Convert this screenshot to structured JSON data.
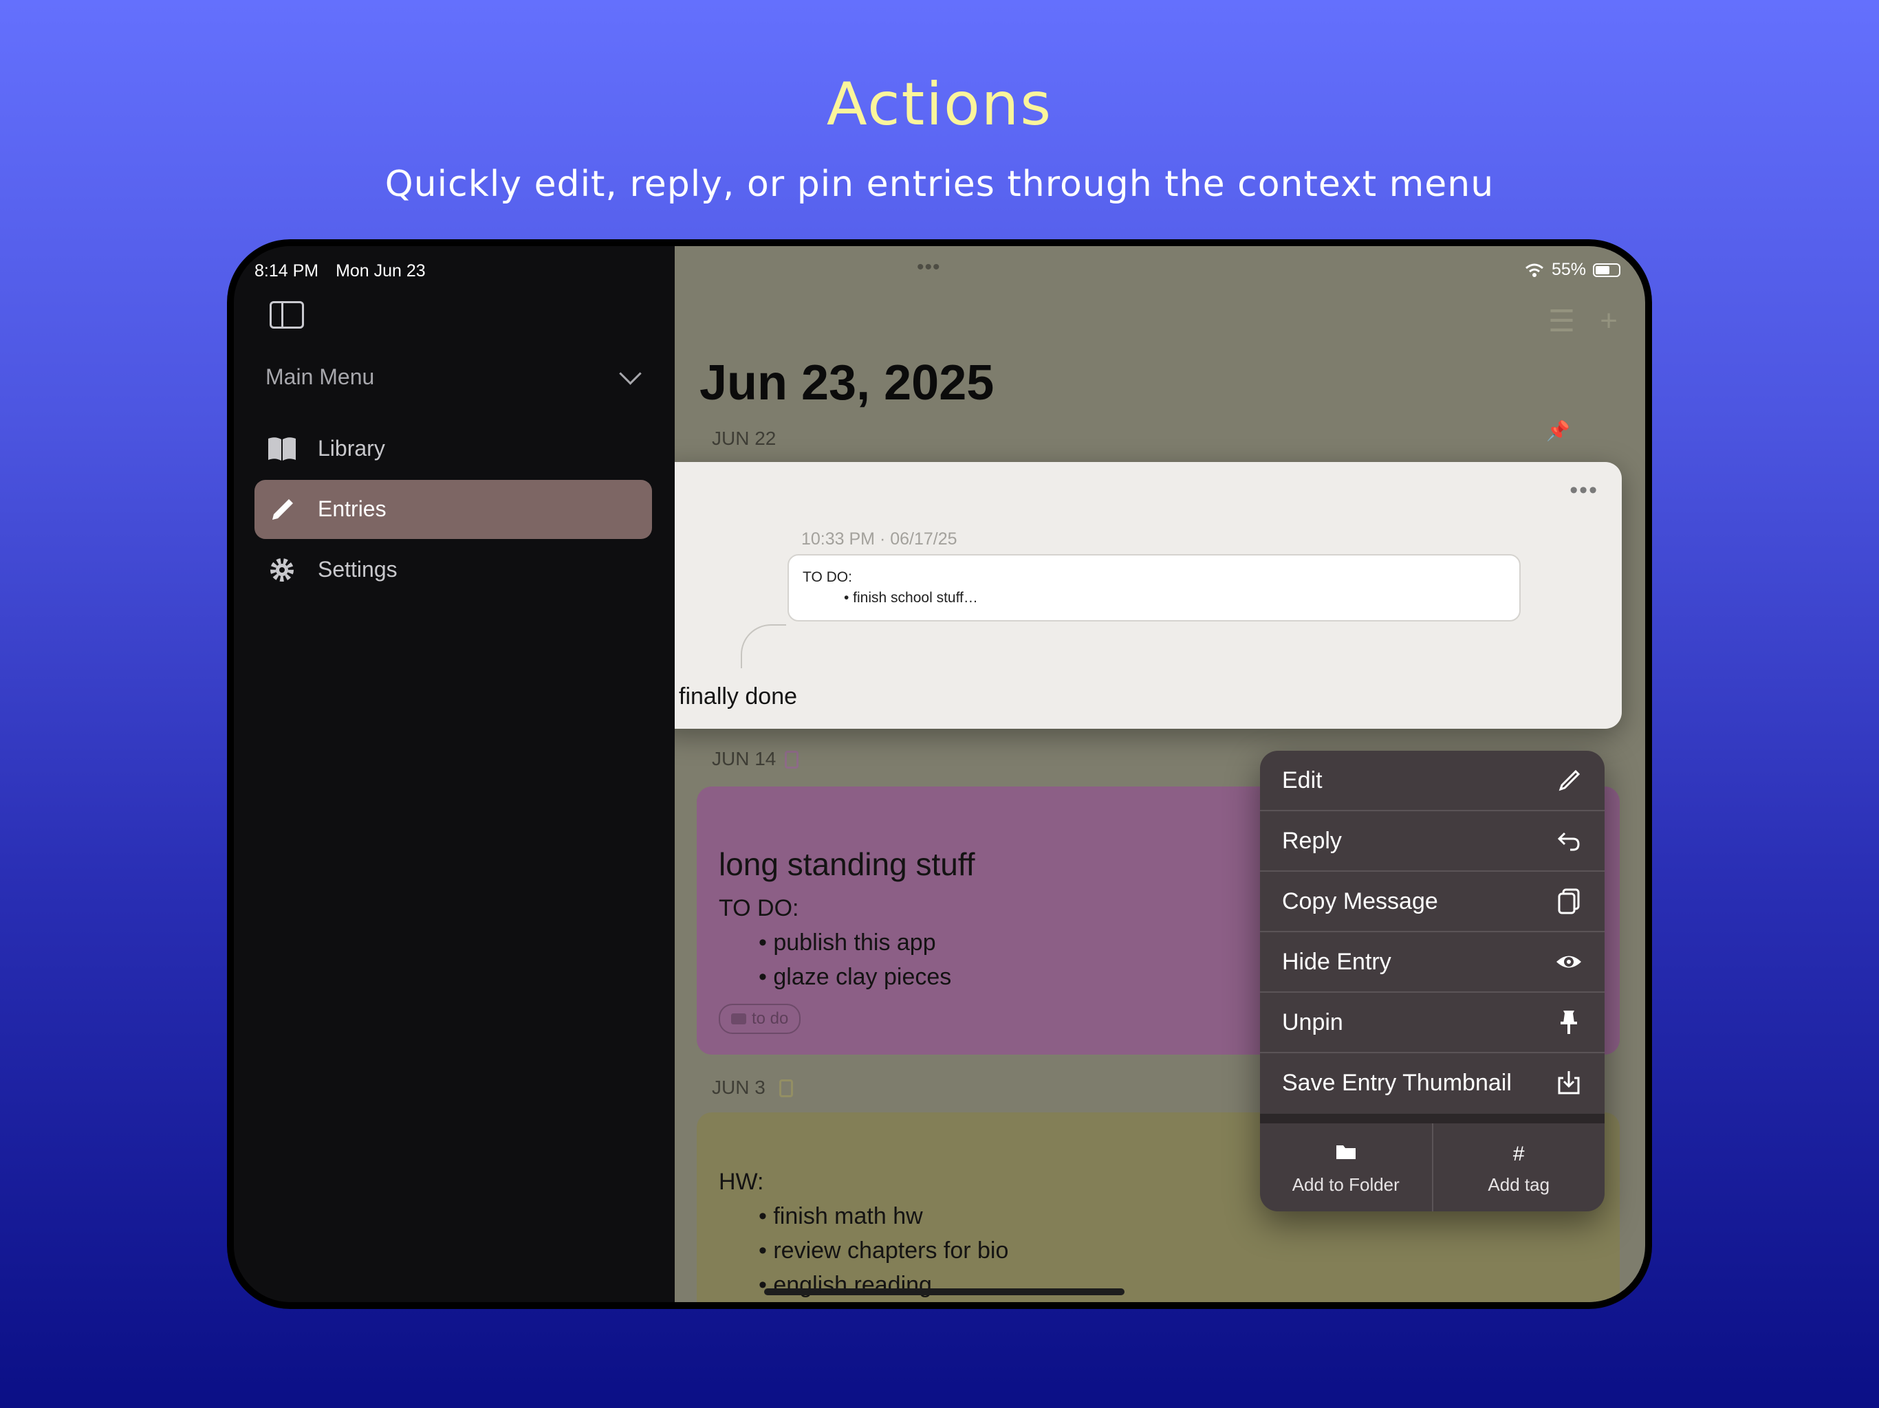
{
  "marketing": {
    "headline": "Actions",
    "subhead": "Quickly edit, reply, or pin entries through the context menu"
  },
  "status": {
    "time": "8:14 PM",
    "date": "Mon Jun 23",
    "battery": "55%"
  },
  "sidebar": {
    "menu_title": "Main Menu",
    "items": [
      {
        "label": "Library",
        "icon": "book-icon"
      },
      {
        "label": "Entries",
        "icon": "pencil-icon",
        "active": true
      },
      {
        "label": "Settings",
        "icon": "gear-icon"
      }
    ]
  },
  "main": {
    "page_title": "Jun 23, 2025",
    "days": [
      "JUN 22",
      "JUN 14",
      "JUN 3"
    ],
    "preview": {
      "timestamp": "10:33 PM · 06/17/25",
      "quote_line1": "TO DO:",
      "quote_line2": "• finish school stuff…",
      "reply_text": "finally done"
    },
    "card_purple": {
      "title": "long standing stuff",
      "line1": "TO DO:",
      "bullet1": "• publish this app",
      "bullet2": "• glaze clay pieces",
      "tag": "to do",
      "color": "#8c5f86"
    },
    "card_olive": {
      "line1": "HW:",
      "bullet1": "• finish math hw",
      "bullet2": "• review chapters for bio",
      "bullet3": "• english reading",
      "color": "#837f57"
    }
  },
  "context_menu": {
    "items": [
      {
        "label": "Edit",
        "icon": "pencil-icon"
      },
      {
        "label": "Reply",
        "icon": "reply-arrow-icon"
      },
      {
        "label": "Copy Message",
        "icon": "copy-icon"
      },
      {
        "label": "Hide Entry",
        "icon": "eye-icon"
      },
      {
        "label": "Unpin",
        "icon": "pin-icon"
      },
      {
        "label": "Save Entry Thumbnail",
        "icon": "save-download-icon"
      }
    ],
    "bottom": [
      {
        "label": "Add to Folder",
        "icon": "folder-icon"
      },
      {
        "label": "Add tag",
        "icon": "hash-icon",
        "glyph": "#"
      }
    ]
  },
  "colors": {
    "accent_yellow": "#fbf59b",
    "sidebar_active": "#7d6664",
    "menu_bg": "#433c3f"
  }
}
